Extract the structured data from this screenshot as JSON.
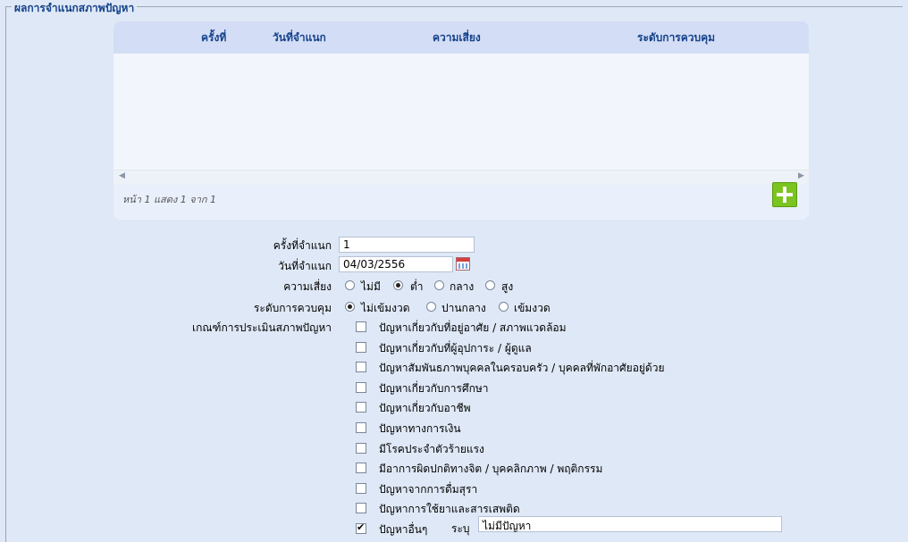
{
  "section_title": "ผลการจำแนกสภาพปัญหา",
  "grid": {
    "columns": [
      "ครั้งที่",
      "วันที่จำแนก",
      "ความเสี่ยง",
      "ระดับการควบคุม"
    ],
    "rows": [],
    "pager_text": "หน้า 1 แสดง 1 จาก 1",
    "scroll_left": "◀",
    "scroll_right": "▶"
  },
  "form": {
    "round_label": "ครั้งที่จำแนก",
    "round_value": "1",
    "date_label": "วันที่จำแนก",
    "date_value": "04/03/2556",
    "risk_label": "ความเสี่ยง",
    "risk_options": [
      "ไม่มี",
      "ต่ำ",
      "กลาง",
      "สูง"
    ],
    "risk_selected": "ต่ำ",
    "control_label": "ระดับการควบคุม",
    "control_options": [
      "ไม่เข้มงวด",
      "ปานกลาง",
      "เข้มงวด"
    ],
    "control_selected": "ไม่เข้มงวด",
    "criteria_label": "เกณฑ์การประเมินสภาพปัญหา",
    "criteria": [
      {
        "label": "ปัญหาเกี่ยวกับที่อยู่อาศัย  / สภาพแวดล้อม",
        "checked": false
      },
      {
        "label": "ปัญหาเกี่ยวกับที่ผู้อุปการะ  / ผู้ดูแล",
        "checked": false
      },
      {
        "label": "ปัญหาสัมพันธภาพบุคคลในครอบครัว  / บุคคลที่พักอาศัยอยู่ด้วย",
        "checked": false
      },
      {
        "label": "ปัญหาเกี่ยวกับการศึกษา",
        "checked": false
      },
      {
        "label": "ปัญหาเกี่ยวกับอาชีพ",
        "checked": false
      },
      {
        "label": "ปัญหาทางการเงิน",
        "checked": false
      },
      {
        "label": "มีโรคประจำตัวร้ายแรง",
        "checked": false
      },
      {
        "label": "มีอาการผิดปกติทางจิต  / บุคคลิกภาพ  / พฤติกรรม",
        "checked": false
      },
      {
        "label": "ปัญหาจากการดื่มสุรา",
        "checked": false
      },
      {
        "label": "ปัญหาการใช้ยาและสารเสพติด",
        "checked": false
      },
      {
        "label": "ปัญหาอื่นๆ",
        "checked": true
      }
    ],
    "other_specify_label": "ระบุ",
    "other_specify_value": "ไม่มีปัญหา"
  }
}
